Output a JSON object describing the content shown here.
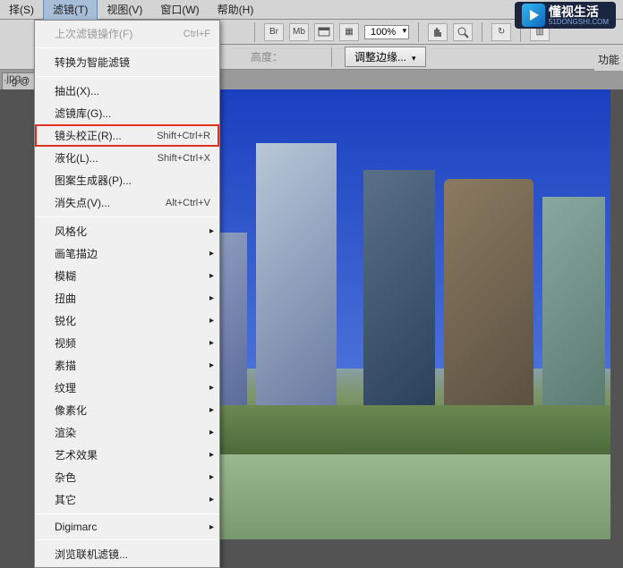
{
  "menubar": {
    "items": [
      {
        "label": "择(S)"
      },
      {
        "label": "滤镜(T)"
      },
      {
        "label": "视图(V)"
      },
      {
        "label": "窗口(W)"
      },
      {
        "label": "帮助(H)"
      }
    ]
  },
  "toolbar": {
    "br": "Br",
    "mb": "Mb",
    "zoom": "100%",
    "heightLabel": "高度：",
    "adjustEdges": "调整边缘..."
  },
  "tabbar": {
    "tab": "g @"
  },
  "leftEdge": {
    "item": ".jpg"
  },
  "rightLabel": "功能",
  "dropdown": {
    "items": [
      {
        "label": "上次滤镜操作(F)",
        "shortcut": "Ctrl+F",
        "disabled": true
      },
      {
        "sep": true
      },
      {
        "label": "转换为智能滤镜"
      },
      {
        "sep": true
      },
      {
        "label": "抽出(X)..."
      },
      {
        "label": "滤镜库(G)..."
      },
      {
        "label": "镜头校正(R)...",
        "shortcut": "Shift+Ctrl+R",
        "highlight": true
      },
      {
        "label": "液化(L)...",
        "shortcut": "Shift+Ctrl+X"
      },
      {
        "label": "图案生成器(P)..."
      },
      {
        "label": "消失点(V)...",
        "shortcut": "Alt+Ctrl+V"
      },
      {
        "sep": true
      },
      {
        "label": "风格化",
        "submenu": true
      },
      {
        "label": "画笔描边",
        "submenu": true
      },
      {
        "label": "模糊",
        "submenu": true
      },
      {
        "label": "扭曲",
        "submenu": true
      },
      {
        "label": "锐化",
        "submenu": true
      },
      {
        "label": "视频",
        "submenu": true
      },
      {
        "label": "素描",
        "submenu": true
      },
      {
        "label": "纹理",
        "submenu": true
      },
      {
        "label": "像素化",
        "submenu": true
      },
      {
        "label": "渲染",
        "submenu": true
      },
      {
        "label": "艺术效果",
        "submenu": true
      },
      {
        "label": "杂色",
        "submenu": true
      },
      {
        "label": "其它",
        "submenu": true
      },
      {
        "sep": true
      },
      {
        "label": "Digimarc",
        "submenu": true
      },
      {
        "sep": true
      },
      {
        "label": "浏览联机滤镜..."
      }
    ]
  },
  "logo": {
    "text": "懂视生活",
    "sub": "51DONGSHI.COM"
  }
}
